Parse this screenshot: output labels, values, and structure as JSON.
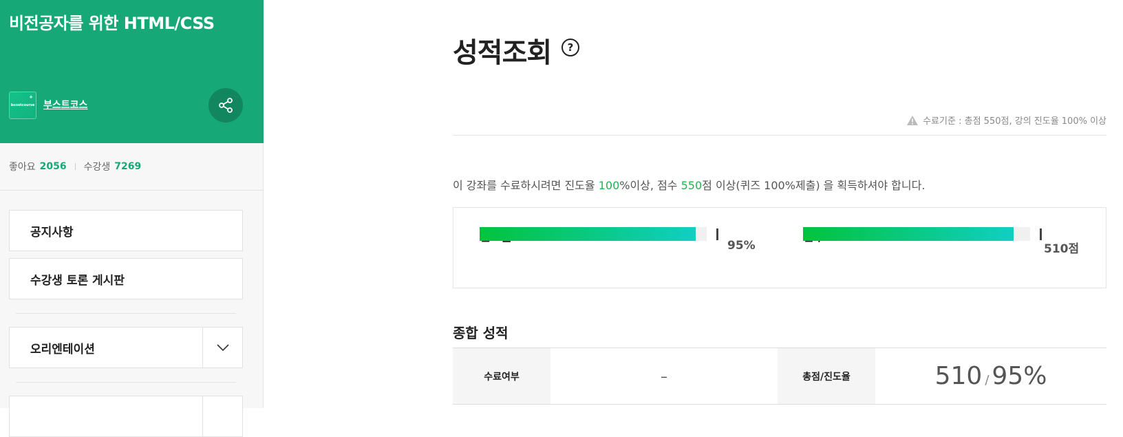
{
  "sidebar": {
    "course_title": "비전공자를 위한 HTML/CSS",
    "provider": {
      "logo_text": "boostcourse",
      "name": "부스트코스"
    },
    "stats": {
      "likes_label": "좋아요",
      "likes": "2056",
      "students_label": "수강생",
      "students": "7269"
    },
    "menu": [
      {
        "label": "공지사항"
      },
      {
        "label": "수강생 토론 게시판"
      },
      {
        "label": "오리엔테이션"
      }
    ]
  },
  "main": {
    "title": "성적조회",
    "criteria": "수료기준 : 총점 550점, 강의 진도율 100% 이상",
    "notice": {
      "p1": "이 강좌를 수료하시려면 진도율 ",
      "hl1": "100",
      "p2": "%이상, 점수 ",
      "hl2": "550",
      "p3": "점 이상(퀴즈 100%제출) 을 획득하셔야 합니다."
    },
    "progress": {
      "label": "진도율",
      "value_text": "95%",
      "fraction": 0.95,
      "target_fraction": 1.0
    },
    "score": {
      "label": "점수",
      "value_text": "510점",
      "fraction": 0.927,
      "target_fraction": 1.0
    },
    "summary": {
      "title": "종합 성적",
      "completion_label": "수료여부",
      "completion_value": "–",
      "total_label": "총점/진도율",
      "total_score": "510",
      "slash": "/",
      "total_progress": "95%"
    }
  },
  "colors": {
    "brand": "#16a877",
    "highlight": "#22b34e",
    "bar_start": "#03c33d",
    "bar_end": "#10cfc3"
  }
}
